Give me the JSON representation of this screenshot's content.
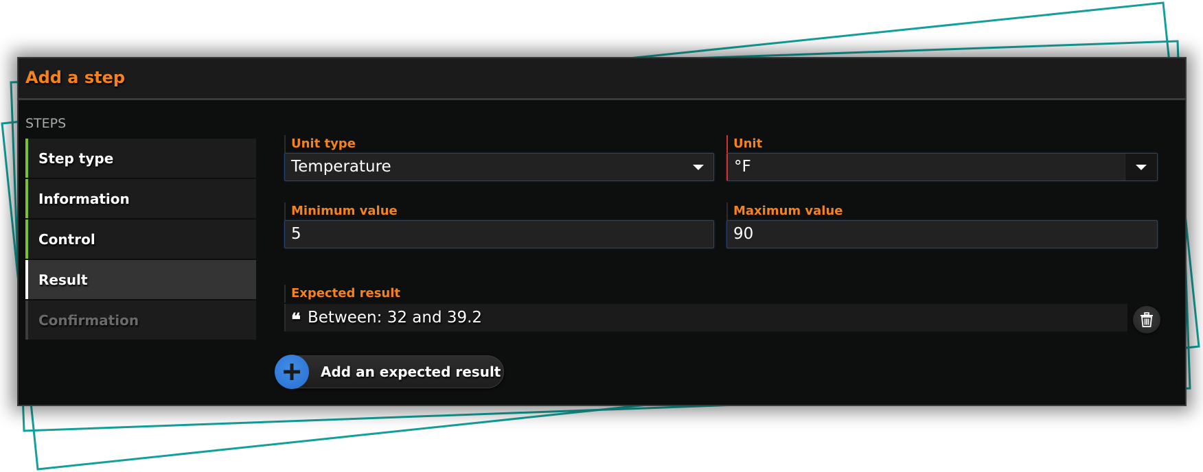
{
  "dialog": {
    "title": "Add a step",
    "steps_heading": "STEPS"
  },
  "sidebar": {
    "items": [
      {
        "label": "Step type",
        "state": "completed"
      },
      {
        "label": "Information",
        "state": "completed"
      },
      {
        "label": "Control",
        "state": "completed"
      },
      {
        "label": "Result",
        "state": "active"
      },
      {
        "label": "Confirmation",
        "state": "disabled"
      }
    ]
  },
  "form": {
    "unit_type": {
      "label": "Unit type",
      "value": "Temperature"
    },
    "unit": {
      "label": "Unit",
      "value": "°F",
      "required": true
    },
    "minimum_value": {
      "label": "Minimum value",
      "value": "5"
    },
    "maximum_value": {
      "label": "Maximum value",
      "value": "90"
    },
    "expected_result": {
      "label": "Expected result",
      "items": [
        {
          "text": "Between: 32 and 39.2"
        }
      ]
    },
    "add_expected_result_label": "Add an expected result"
  },
  "icons": {
    "dropdown": "caret-down-icon",
    "quote": "quote-icon",
    "delete": "trash-icon",
    "add": "plus-icon"
  },
  "colors": {
    "accent_orange": "#f4821f",
    "completed_green": "#7cc12f",
    "required_red": "#d93030",
    "add_blue": "#3080dc",
    "frame_teal": "#14a09a"
  }
}
